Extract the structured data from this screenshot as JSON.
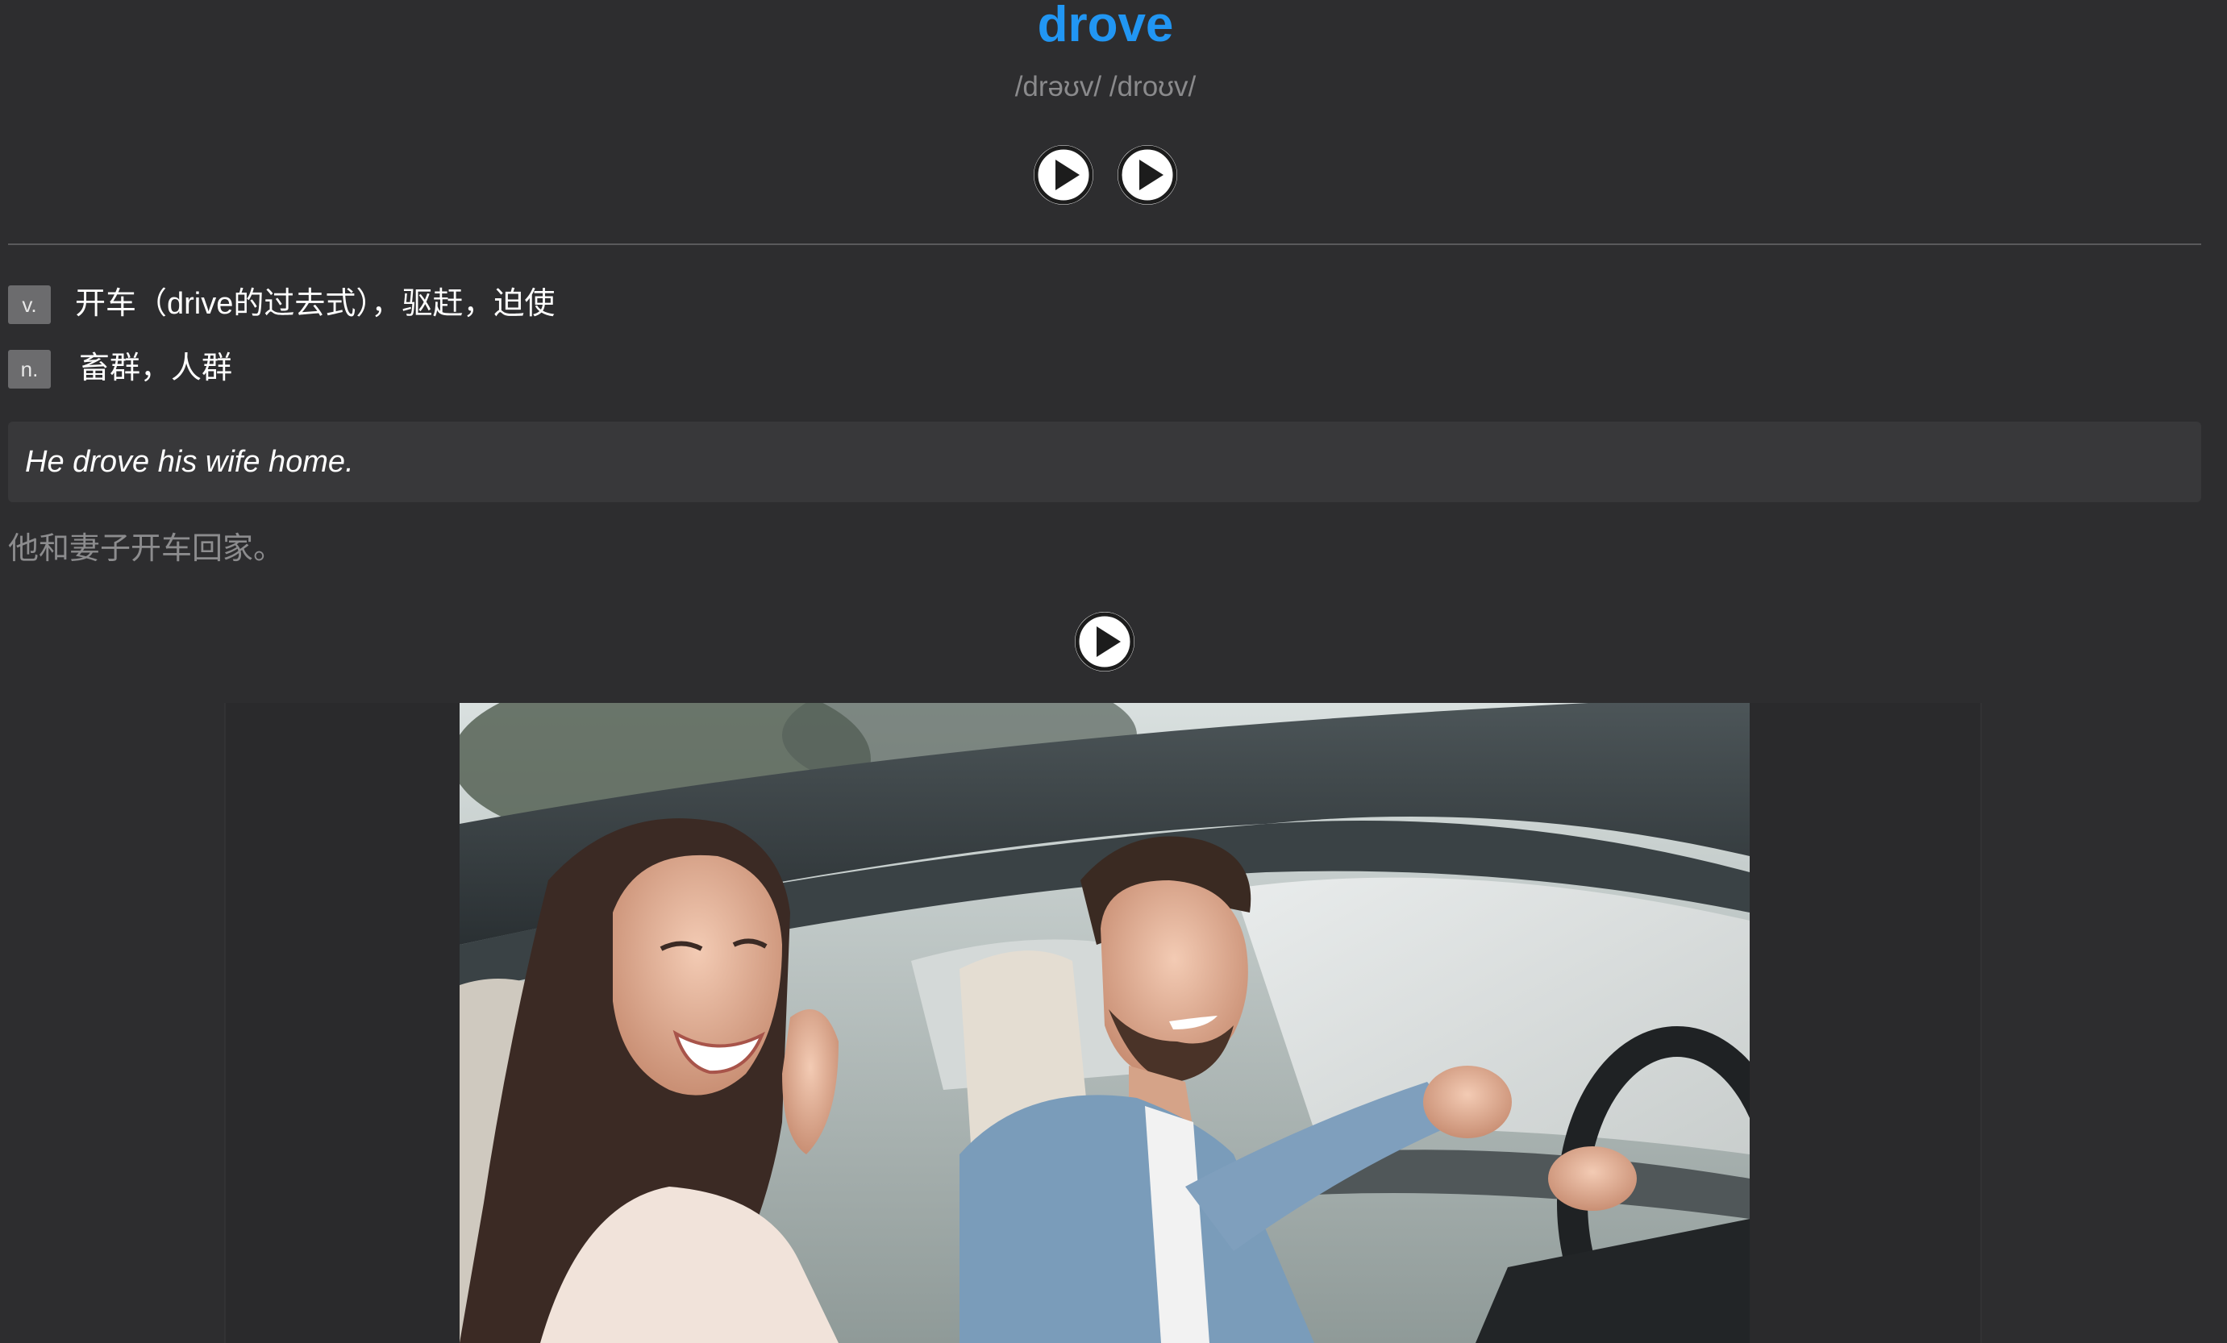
{
  "entry": {
    "word": "drove",
    "phonetic": "/drəʊv/ /droʊv/",
    "audio_buttons": [
      "play-icon",
      "play-icon"
    ]
  },
  "definitions": [
    {
      "pos": "v.",
      "meaning": "开车（drive的过去式），驱赶，迫使"
    },
    {
      "pos": "n.",
      "meaning": "畜群，人群"
    }
  ],
  "example": {
    "english": "He drove his wife home.",
    "chinese": "他和妻子开车回家。",
    "audio_button": "play-icon"
  },
  "image": {
    "subject": "couple-in-car-photo"
  },
  "colors": {
    "background": "#2d2d2f",
    "word": "#2196f3",
    "phonetic": "#8a8a8c",
    "example_box": "#38383a",
    "pos_badge": "#6c6c6e"
  }
}
